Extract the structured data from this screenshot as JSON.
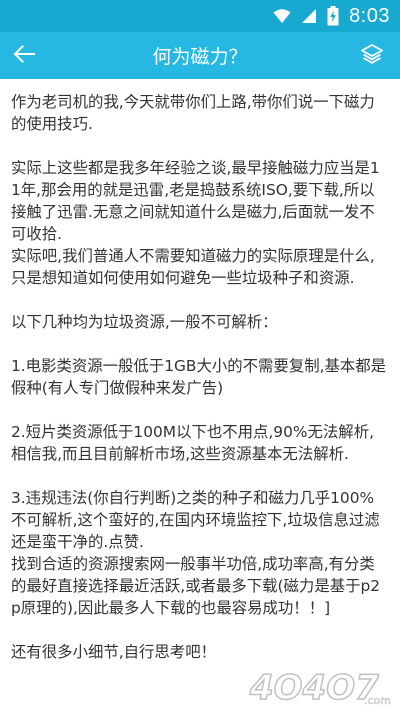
{
  "status_bar": {
    "time": "8:03",
    "icons": [
      "wifi-icon",
      "signal-icon",
      "battery-icon"
    ],
    "bg_color": "#17a9cf"
  },
  "app_bar": {
    "title": "何为磁力？",
    "back_icon": "arrow-left-icon",
    "action_icon": "layers-icon",
    "bg_color": "#26b7e2"
  },
  "article": {
    "text": "作为老司机的我,今天就带你们上路,带你们说一下磁力的使用技巧.\n\n实际上这些都是我多年经验之谈,最早接触磁力应当是11年,那会用的就是迅雷,老是捣鼓系统ISO,要下载,所以接触了迅雷.无意之间就知道什么是磁力,后面就一发不可收拾.\n实际吧,我们普通人不需要知道磁力的实际原理是什么,只是想知道如何使用如何避免一些垃圾种子和资源.\n\n以下几种均为垃圾资源,一般不可解析：\n\n1.电影类资源一般低于1GB大小的不需要复制,基本都是假种(有人专门做假种来发广告)\n\n2.短片类资源低于100M以下也不用点,90%无法解析,相信我,而且目前解析市场,这些资源基本无法解析.\n\n3.违规违法(你自行判断)之类的种子和磁力几乎100%不可解析,这个蛮好的,在国内环境监控下,垃圾信息过滤还是蛮干净的.点赞.\n找到合适的资源搜索网一般事半功倍,成功率高,有分类的最好直接选择最近活跃,或者最多下载(磁力是基于p2p原理的),因此最多人下载的也最容易成功！！]\n\n还有很多小细节,自行思考吧！"
  },
  "watermark": {
    "text": "4O4O7",
    "suffix": ".com"
  }
}
